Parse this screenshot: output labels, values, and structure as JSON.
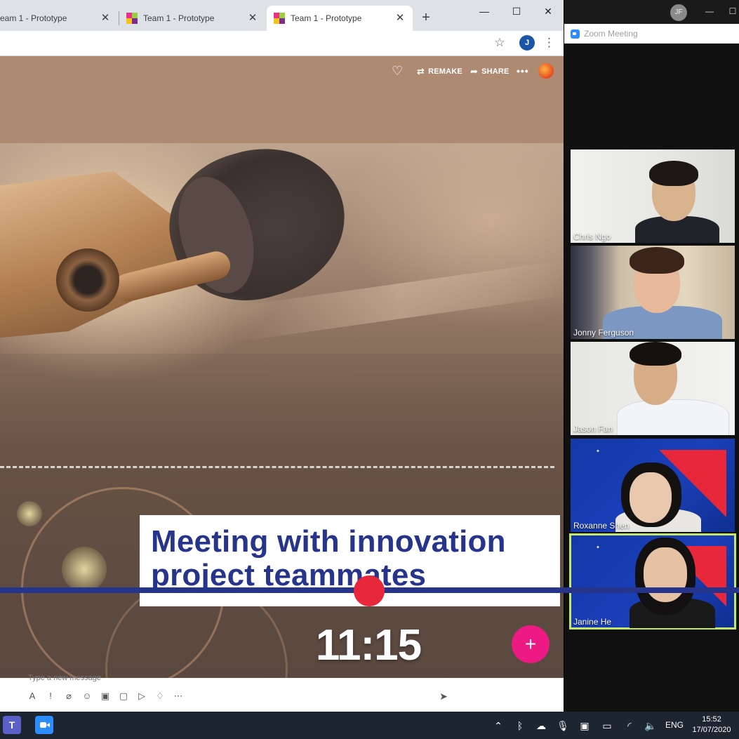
{
  "browser": {
    "tabs": [
      {
        "label": "eam 1 - Prototype"
      },
      {
        "label": "Team 1 - Prototype"
      },
      {
        "label": "Team 1 - Prototype"
      }
    ],
    "avatar_initial": "J"
  },
  "spark": {
    "actions": {
      "remake": "REMAKE",
      "share": "SHARE"
    },
    "caption": [
      "Meeting with innovation",
      "project teammates"
    ],
    "timestamp": "11:15",
    "composer_hint": "Type a new message"
  },
  "zoom": {
    "title": "Zoom Meeting",
    "user_initials": "JF",
    "participants": [
      {
        "name": "Chris Ngo"
      },
      {
        "name": "Jonny Ferguson"
      },
      {
        "name": "Jason Fan"
      },
      {
        "name": "Roxanne Shen"
      },
      {
        "name": "Janine He"
      }
    ]
  },
  "taskbar": {
    "language": "ENG",
    "time": "15:52",
    "date": "17/07/2020"
  },
  "icons": {
    "heart": "heart-icon",
    "remake": "remake-icon",
    "share": "share-icon",
    "plus": "plus-icon"
  },
  "colors": {
    "caption_text": "#27348b",
    "timeline": "#27348b",
    "scrubber": "#e8283a",
    "plus_button": "#ec1a82",
    "header_bg": "#af8a72",
    "active_speaker": "#c3e86a"
  }
}
